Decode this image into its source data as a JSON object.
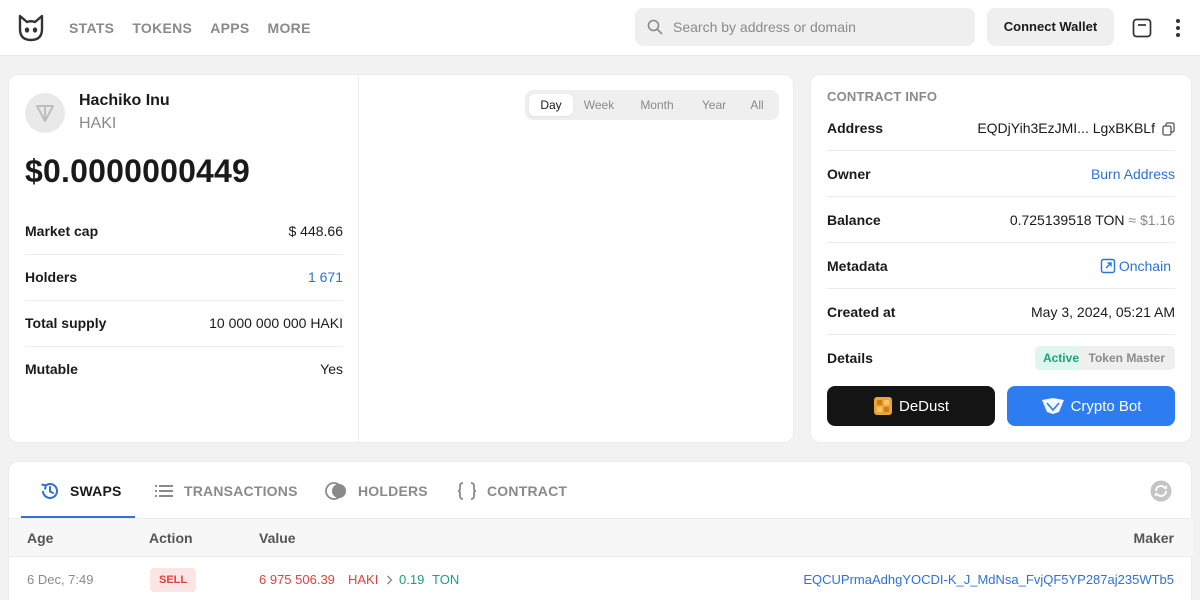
{
  "header": {
    "nav": [
      "STATS",
      "TOKENS",
      "APPS",
      "MORE"
    ],
    "search_placeholder": "Search by address or domain",
    "connect_label": "Connect Wallet"
  },
  "token": {
    "name": "Hachiko Inu",
    "symbol": "HAKI",
    "price": "$0.0000000449",
    "stats": [
      {
        "label": "Market cap",
        "value": "$ 448.66"
      },
      {
        "label": "Holders",
        "value": "1 671"
      },
      {
        "label": "Total supply",
        "value": "10 000 000 000 HAKI"
      },
      {
        "label": "Mutable",
        "value": "Yes"
      }
    ],
    "ranges": [
      "Day",
      "Week",
      "Month",
      "Year",
      "All"
    ],
    "active_range": "Day"
  },
  "contract": {
    "title": "CONTRACT INFO",
    "address_label": "Address",
    "address_value": "EQDjYih3EzJMI... LgxBKBLf",
    "owner_label": "Owner",
    "owner_value": "Burn Address",
    "balance_label": "Balance",
    "balance_value": "0.725139518 TON",
    "balance_fiat": "≈ $1.16",
    "metadata_label": "Metadata",
    "metadata_value": "Onchain",
    "created_label": "Created at",
    "created_value": "May 3, 2024, 05:21 AM",
    "details_label": "Details",
    "badge_active": "Active",
    "badge_master": "Token Master",
    "dedust_label": "DeDust",
    "cryptobot_label": "Crypto Bot"
  },
  "tabs": {
    "items": [
      "SWAPS",
      "TRANSACTIONS",
      "HOLDERS",
      "CONTRACT"
    ],
    "active": "SWAPS"
  },
  "table": {
    "headers": [
      "Age",
      "Action",
      "Value",
      "Maker"
    ],
    "rows": [
      {
        "age": "6 Dec, 7:49",
        "action": "SELL",
        "value_amount": "6 975 506.39",
        "value_token": "HAKI",
        "value_out": "0.19",
        "value_out_token": "TON",
        "maker": "EQCUPrmaAdhgYOCDI-K_J_MdNsa_FvjQF5YP287aj235WTb5"
      }
    ]
  },
  "colors": {
    "link": "#2c72d8",
    "sell": "#e0423c",
    "buy_green": "#19a37a"
  }
}
